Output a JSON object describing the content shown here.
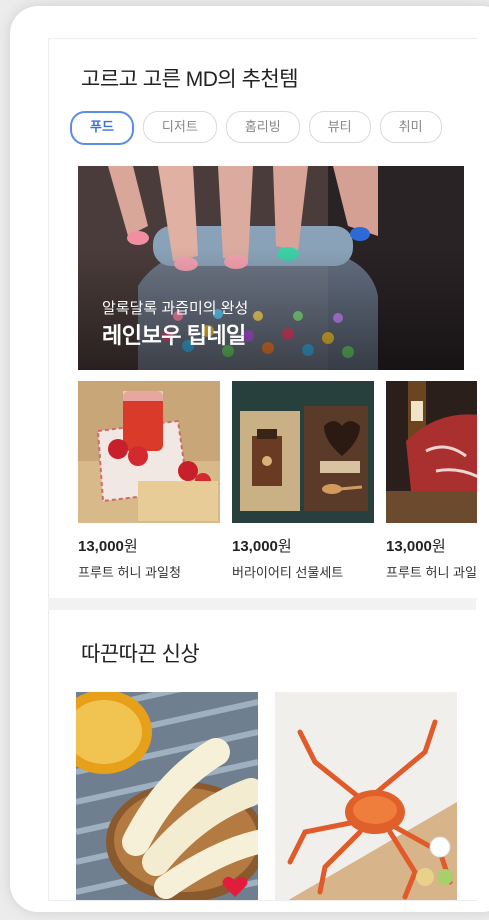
{
  "section1": {
    "title": "고르고 고른 MD의 추천템",
    "chips": [
      "푸드",
      "디저트",
      "홈리빙",
      "뷰티",
      "취미"
    ],
    "hero": {
      "subtitle": "알록달록 과즙미의 완성",
      "title": "레인보우 팁네일"
    },
    "products": [
      {
        "price": "13,000",
        "unit": "원",
        "name": "프루트 허니 과일청"
      },
      {
        "price": "13,000",
        "unit": "원",
        "name": "버라이어티 선물세트"
      },
      {
        "price": "13,000",
        "unit": "원",
        "name": "프루트 허니 과일청"
      }
    ]
  },
  "section2": {
    "title": "따끈따끈 신상"
  },
  "icons": {
    "heart": "heart-icon"
  },
  "colors": {
    "accent": "#3d73d6",
    "heart": "#e21c3d"
  }
}
